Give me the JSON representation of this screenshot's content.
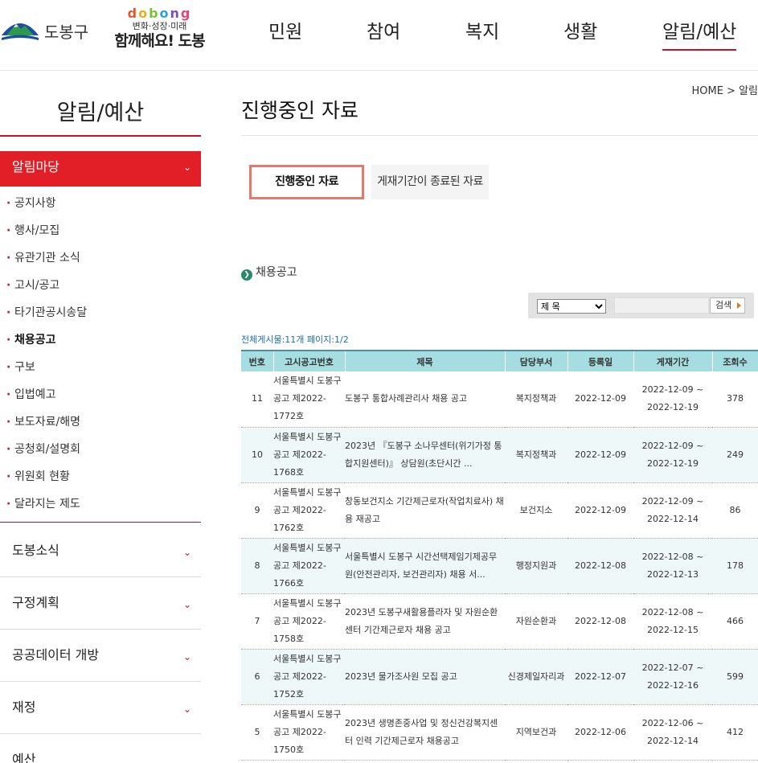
{
  "header": {
    "logo_text": "도봉구",
    "slogan_top": [
      "d",
      "o",
      "b",
      "o",
      "n",
      "g"
    ],
    "slogan_mid": "변화·성장·미래",
    "slogan_bottom": "함께해요! 도봉",
    "nav": [
      "민원",
      "참여",
      "복지",
      "생활",
      "알림/예산"
    ],
    "nav_active": "알림/예산"
  },
  "sidebar": {
    "title": "알림/예산",
    "active_group": "알림마당",
    "sub_items": [
      "공지사항",
      "행사/모집",
      "유관기관 소식",
      "고시/공고",
      "타기관공시송달",
      "채용공고",
      "구보",
      "입법예고",
      "보도자료/해명",
      "공청회/설명회",
      "위원회 현황",
      "달라지는 제도"
    ],
    "current_sub": "채용공고",
    "menu": [
      "도봉소식",
      "구정계획",
      "공공데이터 개방",
      "재정",
      "예산"
    ]
  },
  "content": {
    "breadcrumb": "HOME > 알림",
    "page_title": "진행중인 자료",
    "tab_active": "진행중인 자료",
    "tab_inactive": "게재기간이 종료된 자료",
    "board_label": "채용공고",
    "search": {
      "select_value": "제 목",
      "button": "검색"
    },
    "count_info": "전체게시물:11개 페이지:1/2",
    "columns": [
      "번호",
      "고시공고번호",
      "제목",
      "담당부서",
      "등록일",
      "게재기간",
      "조회수"
    ],
    "rows": [
      {
        "no": "11",
        "notice": "서울특별시 도봉구 공고 제2022-1772호",
        "title": "도봉구 통합사례관리사 채용 공고",
        "dept": "복지정책과",
        "date": "2022-12-09",
        "period_start": "2022-12-09 ~",
        "period_end": "2022-12-19",
        "views": "378"
      },
      {
        "no": "10",
        "notice": "서울특별시 도봉구 공고 제2022-1768호",
        "title": "2023년 『도봉구 소나무센터(위기가정 통합지원센터)』 상담원(초단시간 ...",
        "dept": "복지정책과",
        "date": "2022-12-09",
        "period_start": "2022-12-09 ~",
        "period_end": "2022-12-19",
        "views": "249"
      },
      {
        "no": "9",
        "notice": "서울특별시 도봉구 공고 제2022-1762호",
        "title": "창동보건지소 기간제근로자(작업치료사) 채용 재공고",
        "dept": "보건지소",
        "date": "2022-12-09",
        "period_start": "2022-12-09 ~",
        "period_end": "2022-12-14",
        "views": "86"
      },
      {
        "no": "8",
        "notice": "서울특별시 도봉구 공고 제2022-1766호",
        "title": "서울특별시 도봉구 시간선택제임기제공무원(안전관리자, 보건관리자) 채용 서...",
        "dept": "행정지원과",
        "date": "2022-12-08",
        "period_start": "2022-12-08 ~",
        "period_end": "2022-12-13",
        "views": "178"
      },
      {
        "no": "7",
        "notice": "서울특별시 도봉구 공고 제2022-1758호",
        "title": "2023년 도봉구새활용플라자 및 자원순환센터 기간제근로자 채용 공고",
        "dept": "자원순환과",
        "date": "2022-12-08",
        "period_start": "2022-12-08 ~",
        "period_end": "2022-12-15",
        "views": "466"
      },
      {
        "no": "6",
        "notice": "서울특별시 도봉구 공고 제2022-1752호",
        "title": "2023년 물가조사원 모집 공고",
        "dept": "신경제일자리과",
        "date": "2022-12-07",
        "period_start": "2022-12-07 ~",
        "period_end": "2022-12-16",
        "views": "599"
      },
      {
        "no": "5",
        "notice": "서울특별시 도봉구 공고 제2022-1750호",
        "title": "2023년 생명존중사업 및 정신건강복지센터 인력 기간제근로자 채용공고",
        "dept": "지역보건과",
        "date": "2022-12-06",
        "period_start": "2022-12-06 ~",
        "period_end": "2022-12-14",
        "views": "412"
      }
    ]
  }
}
